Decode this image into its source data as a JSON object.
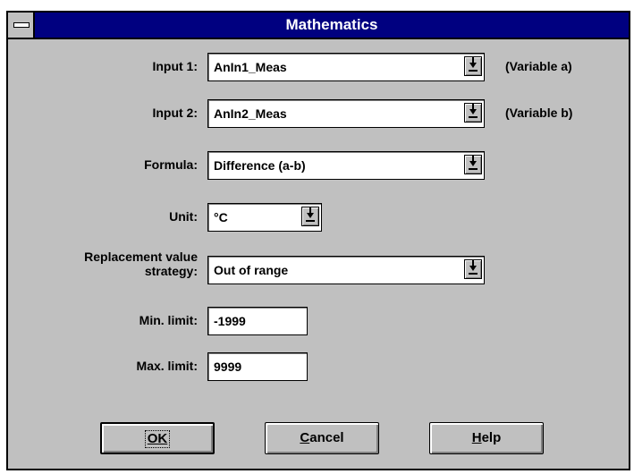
{
  "window": {
    "title": "Mathematics",
    "sysmenu_icon": "system-menu-icon"
  },
  "fields": {
    "input1": {
      "label": "Input 1:",
      "value": "AnIn1_Meas",
      "suffix": "(Variable a)"
    },
    "input2": {
      "label": "Input 2:",
      "value": "AnIn2_Meas",
      "suffix": "(Variable b)"
    },
    "formula": {
      "label": "Formula:",
      "value": "Difference (a-b)"
    },
    "unit": {
      "label": "Unit:",
      "value": "°C"
    },
    "replacement": {
      "label": "Replacement value\nstrategy:",
      "value": "Out of range"
    },
    "min_limit": {
      "label": "Min. limit:",
      "value": "-1999"
    },
    "max_limit": {
      "label": "Max. limit:",
      "value": "9999"
    }
  },
  "buttons": {
    "ok": {
      "label": "OK"
    },
    "cancel": {
      "first": "C",
      "rest": "ancel"
    },
    "help": {
      "first": "H",
      "rest": "elp"
    }
  },
  "colors": {
    "titlebar": "#000080",
    "face": "#c0c0c0"
  }
}
